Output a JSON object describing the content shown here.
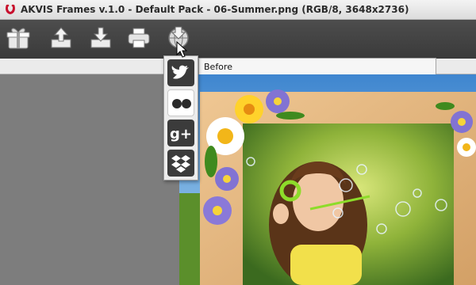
{
  "window": {
    "title": "AKVIS Frames v.1.0 - Default Pack - 06-Summer.png (RGB/8, 3648x2736)",
    "logo_icon": "akvis-logo-icon"
  },
  "toolbar": {
    "buttons": [
      {
        "name": "gift-icon"
      },
      {
        "name": "upload-icon"
      },
      {
        "name": "download-icon"
      },
      {
        "name": "printer-icon"
      },
      {
        "name": "share-icon"
      }
    ]
  },
  "tabs": {
    "before_label": "Before"
  },
  "share_menu": {
    "items": [
      {
        "name": "twitter-icon"
      },
      {
        "name": "flickr-icon"
      },
      {
        "name": "google-plus-icon",
        "label": "g+"
      },
      {
        "name": "dropbox-icon"
      }
    ]
  },
  "colors": {
    "toolbar": "#444444",
    "frame_wood": "#e0b47a",
    "workspace": "#7d7d7d"
  }
}
